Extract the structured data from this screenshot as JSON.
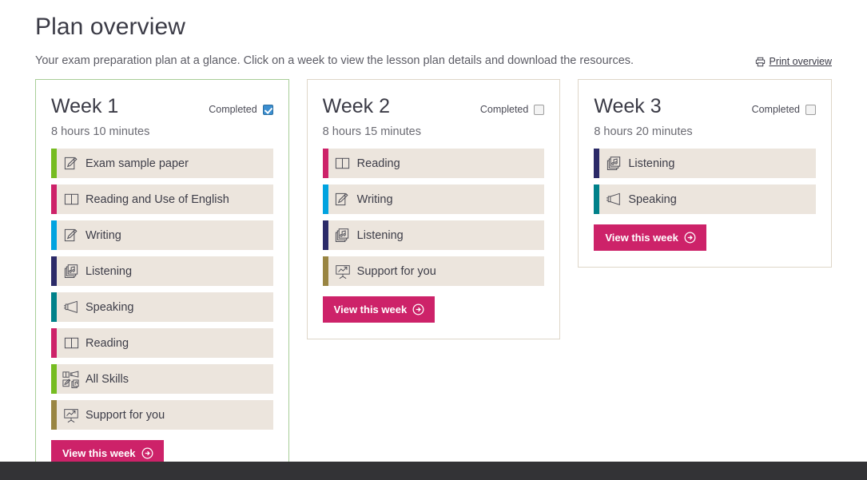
{
  "header": {
    "title": "Plan overview",
    "subtitle": "Your exam preparation plan at a glance. Click on a week to view the lesson plan details and download the resources.",
    "print_link": "Print overview",
    "print_icon": "printer-icon"
  },
  "labels": {
    "completed": "Completed",
    "view_week": "View this week",
    "view_week_icon": "arrow-right-circle-icon"
  },
  "colors": {
    "accent_button": "#cd2269",
    "row_background": "#ece5dd",
    "completed_border": "#a8ce98",
    "default_border": "#ded6c8",
    "checkbox_checked": "#3b8ed0",
    "bottom_bar": "#333336",
    "green": "#76bc21",
    "magenta": "#cd2269",
    "cyan": "#00a3e0",
    "navy": "#2b2a68",
    "teal": "#00818a",
    "olive": "#998542"
  },
  "weeks": [
    {
      "title": "Week 1",
      "duration": "8 hours 10 minutes",
      "completed": true,
      "lessons": [
        {
          "label": "Exam sample paper",
          "icon": "writing-icon",
          "color": "#76bc21"
        },
        {
          "label": "Reading and Use of English",
          "icon": "book-icon",
          "color": "#cd2269"
        },
        {
          "label": "Writing",
          "icon": "writing-icon",
          "color": "#00a3e0"
        },
        {
          "label": "Listening",
          "icon": "listening-icon",
          "color": "#2b2a68"
        },
        {
          "label": "Speaking",
          "icon": "megaphone-icon",
          "color": "#00818a"
        },
        {
          "label": "Reading",
          "icon": "book-icon",
          "color": "#cd2269"
        },
        {
          "label": "All Skills",
          "icon": "all-skills-icon",
          "color": "#76bc21"
        },
        {
          "label": "Support for you",
          "icon": "support-icon",
          "color": "#998542"
        }
      ]
    },
    {
      "title": "Week 2",
      "duration": "8 hours 15 minutes",
      "completed": false,
      "lessons": [
        {
          "label": "Reading",
          "icon": "book-icon",
          "color": "#cd2269"
        },
        {
          "label": "Writing",
          "icon": "writing-icon",
          "color": "#00a3e0"
        },
        {
          "label": "Listening",
          "icon": "listening-icon",
          "color": "#2b2a68"
        },
        {
          "label": "Support for you",
          "icon": "support-icon",
          "color": "#998542"
        }
      ]
    },
    {
      "title": "Week 3",
      "duration": "8 hours 20 minutes",
      "completed": false,
      "lessons": [
        {
          "label": "Listening",
          "icon": "listening-icon",
          "color": "#2b2a68"
        },
        {
          "label": "Speaking",
          "icon": "megaphone-icon",
          "color": "#00818a"
        }
      ]
    }
  ]
}
